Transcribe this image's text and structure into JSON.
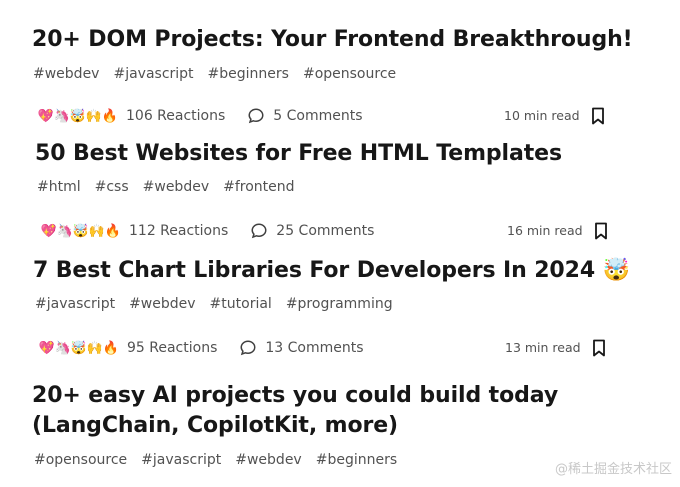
{
  "articles": [
    {
      "title": "20+ DOM Projects: Your Frontend Breakthrough!",
      "tags": [
        "#webdev",
        "#javascript",
        "#beginners",
        "#opensource"
      ],
      "reactions": "106 Reactions",
      "comments": "5 Comments",
      "read_time": "10 min read"
    },
    {
      "title": "50 Best Websites for Free HTML Templates",
      "tags": [
        "#html",
        "#css",
        "#webdev",
        "#frontend"
      ],
      "reactions": "112 Reactions",
      "comments": "25 Comments",
      "read_time": "16 min read"
    },
    {
      "title": "7 Best Chart Libraries For Developers In 2024 🤯",
      "tags": [
        "#javascript",
        "#webdev",
        "#tutorial",
        "#programming"
      ],
      "reactions": "95 Reactions",
      "comments": "13 Comments",
      "read_time": "13 min read"
    },
    {
      "title_line1": "20+ easy AI projects you could build today",
      "title_line2": "(LangChain, CopilotKit, more)",
      "tags": [
        "#opensource",
        "#javascript",
        "#webdev",
        "#beginners"
      ]
    }
  ],
  "reaction_emojis": [
    "💖",
    "🦄",
    "🤯",
    "🙌",
    "🔥"
  ],
  "watermark": "@稀土掘金技术社区"
}
